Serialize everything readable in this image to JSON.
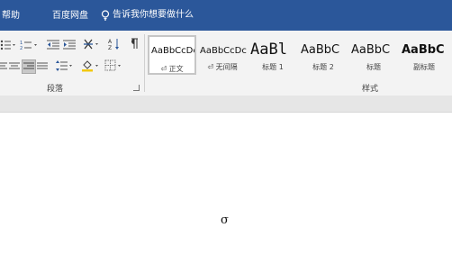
{
  "tabs": {
    "help": "帮助",
    "baidu_netdisk": "百度网盘",
    "tell_me": "告诉我你想要做什么"
  },
  "paragraph_group": {
    "label": "段落"
  },
  "styles_group": {
    "label": "样式",
    "styles": [
      {
        "sample": "AaBbCcDc",
        "name": "⏎ 正文"
      },
      {
        "sample": "AaBbCcDc",
        "name": "⏎ 无间隔"
      },
      {
        "sample": "AaBl",
        "name": "标题 1"
      },
      {
        "sample": "AaBbC",
        "name": "标题 2"
      },
      {
        "sample": "AaBbC",
        "name": "标题"
      },
      {
        "sample": "AaBbC",
        "name": "副标题"
      }
    ]
  },
  "document": {
    "content": "σ"
  },
  "colors": {
    "accent": "#2b579a",
    "ribbon": "#f3f3f3"
  },
  "icons": [
    "bullets-icon",
    "numbering-icon",
    "decrease-indent-icon",
    "increase-indent-icon",
    "chinese-layout-icon",
    "sort-icon",
    "show-marks-icon",
    "align-left-icon",
    "center-icon",
    "align-right-icon",
    "justify-icon",
    "line-spacing-icon",
    "shading-icon",
    "borders-icon",
    "lightbulb-icon"
  ]
}
